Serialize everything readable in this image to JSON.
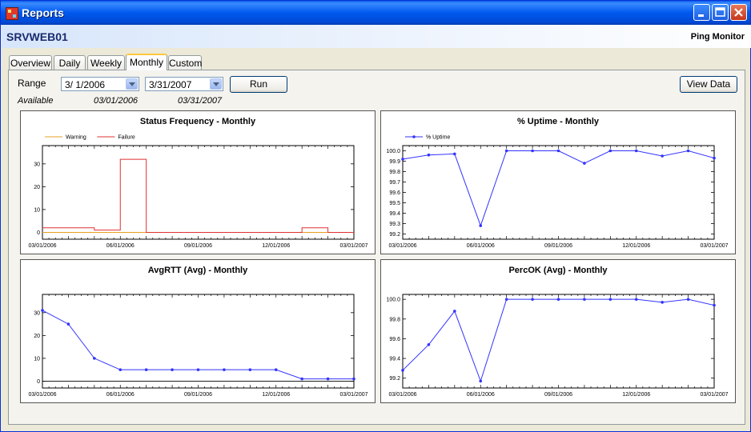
{
  "window": {
    "title": "Reports",
    "icon": "app-report-icon",
    "controls": {
      "minimize": "minimize-icon",
      "maximize": "maximize-icon",
      "close": "close-icon"
    }
  },
  "header": {
    "server": "SRVWEB01",
    "monitor": "Ping Monitor"
  },
  "tabs": [
    {
      "label": "Overview"
    },
    {
      "label": "Daily"
    },
    {
      "label": "Weekly"
    },
    {
      "label": "Monthly",
      "active": true
    },
    {
      "label": "Custom"
    }
  ],
  "range": {
    "label": "Range",
    "from": "3/  1/2006",
    "to": "3/31/2007",
    "run_label": "Run",
    "view_data_label": "View Data",
    "available_label": "Available",
    "available_from": "03/01/2006",
    "available_to": "03/31/2007"
  },
  "colors": {
    "warning": "#e6a020",
    "failure": "#e03030",
    "series": "#3333ff"
  },
  "chart_data": [
    {
      "type": "line",
      "title": "Status Frequency - Monthly",
      "legend": "top-left",
      "x": [
        "03/01/2006",
        "04/01/2006",
        "05/01/2006",
        "06/01/2006",
        "07/01/2006",
        "08/01/2006",
        "09/01/2006",
        "10/01/2006",
        "11/01/2006",
        "12/01/2006",
        "01/01/2007",
        "02/01/2007",
        "03/01/2007"
      ],
      "x_ticks": [
        "03/01/2006",
        "06/01/2006",
        "09/01/2006",
        "12/01/2006",
        "03/01/2007"
      ],
      "y_ticks": [
        "0",
        "10",
        "20",
        "30"
      ],
      "ylim": [
        -3,
        38
      ],
      "step": true,
      "series": [
        {
          "name": "Warning",
          "values": [
            0,
            0,
            0,
            0,
            0,
            0,
            0,
            0,
            0,
            0,
            0,
            0,
            0
          ]
        },
        {
          "name": "Failure",
          "values": [
            2,
            2,
            1,
            32,
            0,
            0,
            0,
            0,
            0,
            0,
            2,
            0,
            0
          ]
        }
      ]
    },
    {
      "type": "line",
      "title": "% Uptime - Monthly",
      "legend": "top-left",
      "x": [
        "03/01/2006",
        "04/01/2006",
        "05/01/2006",
        "06/01/2006",
        "07/01/2006",
        "08/01/2006",
        "09/01/2006",
        "10/01/2006",
        "11/01/2006",
        "12/01/2006",
        "01/01/2007",
        "02/01/2007",
        "03/01/2007"
      ],
      "x_ticks": [
        "03/01/2006",
        "06/01/2006",
        "09/01/2006",
        "12/01/2006",
        "03/01/2007"
      ],
      "y_ticks": [
        "100.0",
        "99.9",
        "99.8",
        "99.7",
        "99.6",
        "99.5",
        "99.4",
        "99.3",
        "99.2"
      ],
      "ylim": [
        99.15,
        100.05
      ],
      "series": [
        {
          "name": "% Uptime",
          "values": [
            99.92,
            99.96,
            99.97,
            99.28,
            100.0,
            100.0,
            100.0,
            99.88,
            100.0,
            100.0,
            99.95,
            100.0,
            99.93
          ]
        }
      ]
    },
    {
      "type": "line",
      "title": "AvgRTT (Avg) - Monthly",
      "x": [
        "03/01/2006",
        "04/01/2006",
        "05/01/2006",
        "06/01/2006",
        "07/01/2006",
        "08/01/2006",
        "09/01/2006",
        "10/01/2006",
        "11/01/2006",
        "12/01/2006",
        "01/01/2007",
        "02/01/2007",
        "03/01/2007"
      ],
      "x_ticks": [
        "03/01/2006",
        "06/01/2006",
        "09/01/2006",
        "12/01/2006",
        "03/01/2007"
      ],
      "y_ticks": [
        "0",
        "10",
        "20",
        "30"
      ],
      "ylim": [
        -3,
        38
      ],
      "series": [
        {
          "values": [
            31,
            25,
            10,
            5,
            5,
            5,
            5,
            5,
            5,
            5,
            1,
            1,
            1
          ]
        }
      ]
    },
    {
      "type": "line",
      "title": "PercOK (Avg) - Monthly",
      "x": [
        "03/01/2006",
        "04/01/2006",
        "05/01/2006",
        "06/01/2006",
        "07/01/2006",
        "08/01/2006",
        "09/01/2006",
        "10/01/2006",
        "11/01/2006",
        "12/01/2006",
        "01/01/2007",
        "02/01/2007",
        "03/01/2007"
      ],
      "x_ticks": [
        "03/01/2006",
        "06/01/2006",
        "09/01/2006",
        "12/01/2006",
        "03/01/2007"
      ],
      "y_ticks": [
        "100.0",
        "99.8",
        "99.6",
        "99.4",
        "99.2"
      ],
      "ylim": [
        99.1,
        100.05
      ],
      "series": [
        {
          "values": [
            99.28,
            99.54,
            99.88,
            99.17,
            100.0,
            100.0,
            100.0,
            100.0,
            100.0,
            100.0,
            99.97,
            100.0,
            99.94
          ]
        }
      ]
    }
  ]
}
